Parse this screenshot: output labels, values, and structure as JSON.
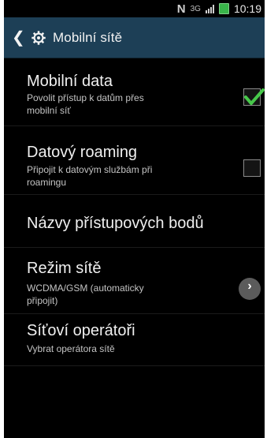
{
  "status_bar": {
    "time": "10:19",
    "data_indicator": "3G",
    "nfc_icon": "n-icon",
    "signal_icon": "signal-icon",
    "battery_icon": "battery-icon"
  },
  "action_bar": {
    "back_icon": "back-icon",
    "settings_icon": "gear-icon",
    "title": "Mobilní sítě"
  },
  "settings": {
    "items": [
      {
        "title": "Mobilní data",
        "subtitle_lines": [
          "Povolit přístup k datům přes",
          "mobilní síť"
        ],
        "control": "checkbox",
        "checked": true
      },
      {
        "title": "Datový roaming",
        "subtitle_lines": [
          "Připojit k datovým službám při",
          "roamingu"
        ],
        "control": "checkbox",
        "checked": false
      },
      {
        "title": "Názvy přístupových bodů",
        "subtitle_lines": [],
        "control": "none"
      },
      {
        "title": "Režim sítě",
        "subtitle_lines": [
          "WCDMA/GSM (automaticky",
          "připojit)"
        ],
        "control": "chevron"
      },
      {
        "title": "Síťoví operátoři",
        "subtitle_lines": [
          "Vybrat operátora sítě"
        ],
        "control": "none"
      }
    ]
  },
  "colors": {
    "action_bar": "#1d3f56",
    "background": "#000000",
    "checkmark": "#47c84a"
  }
}
